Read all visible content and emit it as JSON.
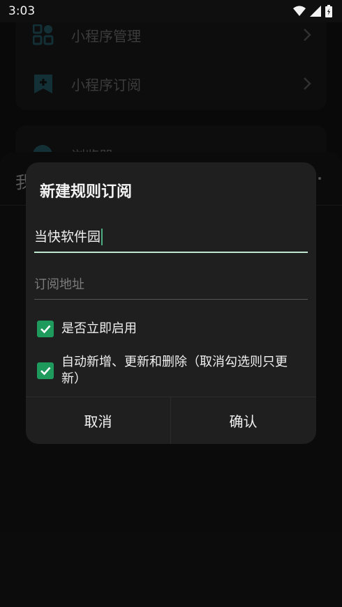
{
  "status_bar": {
    "time": "3:03",
    "icons": [
      "wifi-icon",
      "signal-icon",
      "battery-icon"
    ]
  },
  "background": {
    "menu_items": [
      {
        "label": "小程序管理",
        "icon": "grid-icon"
      },
      {
        "label": "小程序订阅",
        "icon": "bookmark-add-icon"
      },
      {
        "label": "浏览器",
        "icon": "browser-icon"
      }
    ],
    "sheet_title": "我"
  },
  "dialog": {
    "title": "新建规则订阅",
    "name_field": {
      "value": "当快软件园"
    },
    "url_field": {
      "placeholder": "订阅地址",
      "value": ""
    },
    "options": [
      {
        "label": "是否立即启用",
        "checked": true
      },
      {
        "label": "自动新增、更新和删除（取消勾选则只更新）",
        "checked": true
      }
    ],
    "buttons": {
      "cancel": "取消",
      "confirm": "确认"
    },
    "accent_color": "#1f9a5d"
  }
}
